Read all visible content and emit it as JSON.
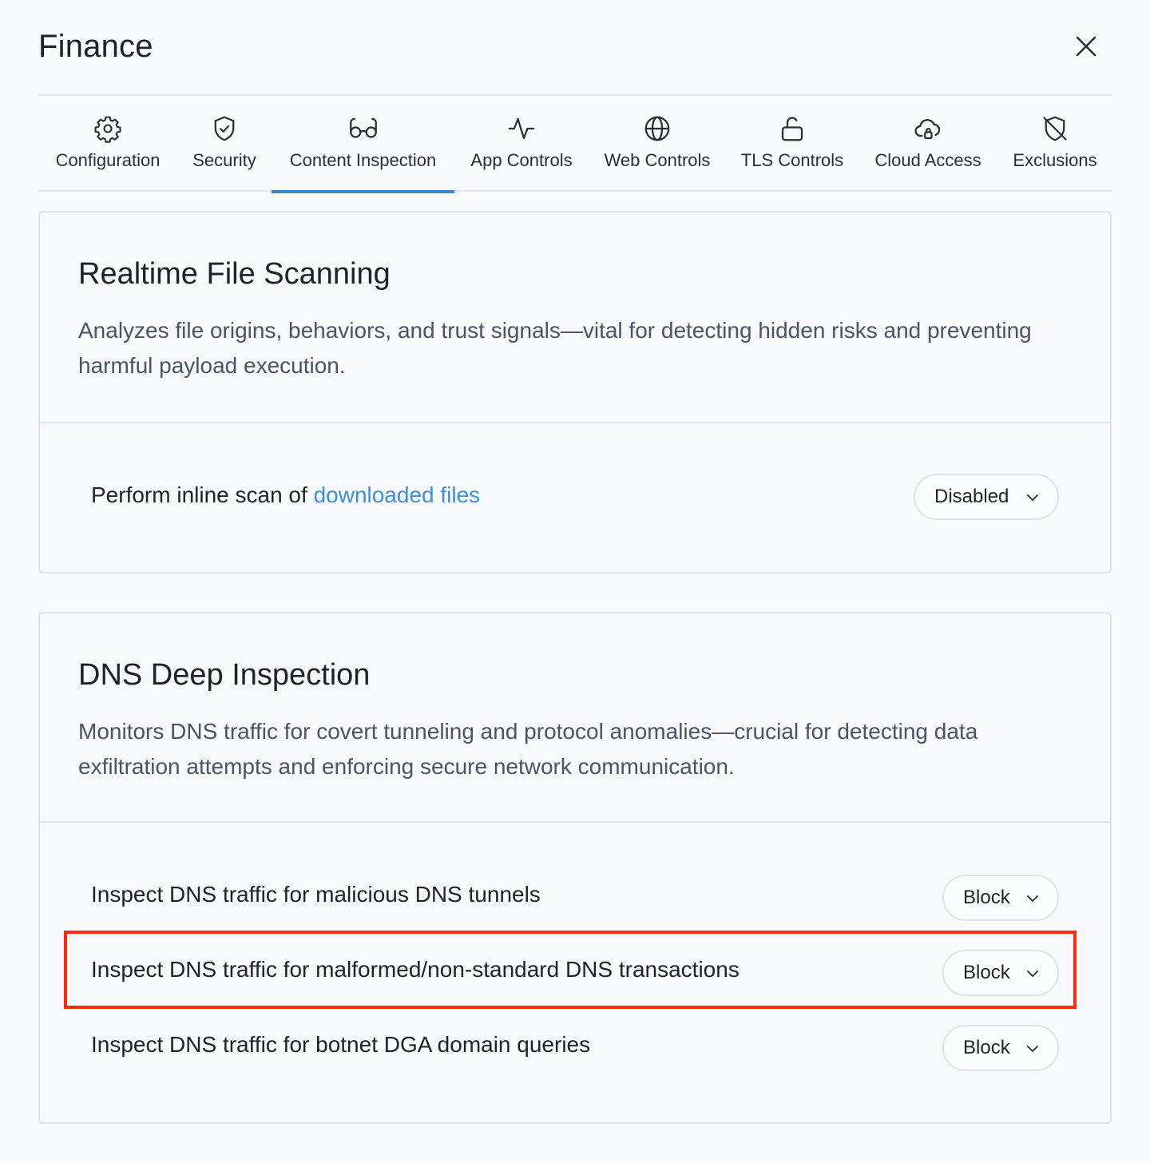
{
  "header": {
    "title": "Finance"
  },
  "tabs": [
    {
      "label": "Configuration",
      "icon": "gear-icon"
    },
    {
      "label": "Security",
      "icon": "shield-check-icon"
    },
    {
      "label": "Content Inspection",
      "icon": "glasses-icon",
      "active": true
    },
    {
      "label": "App Controls",
      "icon": "activity-icon"
    },
    {
      "label": "Web Controls",
      "icon": "globe-icon"
    },
    {
      "label": "TLS Controls",
      "icon": "unlock-icon"
    },
    {
      "label": "Cloud Access",
      "icon": "cloud-lock-icon"
    },
    {
      "label": "Exclusions",
      "icon": "shield-off-icon"
    }
  ],
  "file_scanning": {
    "title": "Realtime File Scanning",
    "description": "Analyzes file origins, behaviors, and trust signals—vital for detecting hidden risks and preventing harmful payload execution.",
    "row": {
      "label_prefix": "Perform inline scan of ",
      "label_link": "downloaded files",
      "value": "Disabled"
    }
  },
  "dns": {
    "title": "DNS Deep Inspection",
    "description": "Monitors DNS traffic for covert tunneling and protocol anomalies—crucial for detecting data exfiltration attempts and enforcing secure network communication.",
    "rows": [
      {
        "label": "Inspect DNS traffic for malicious DNS tunnels",
        "value": "Block"
      },
      {
        "label": "Inspect DNS traffic for malformed/non-standard DNS transactions",
        "value": "Block"
      },
      {
        "label": "Inspect DNS traffic for botnet DGA domain queries",
        "value": "Block"
      }
    ]
  },
  "colors": {
    "accent": "#3b82c8",
    "link": "#3b8fe0",
    "highlight": "#ff2a0a"
  }
}
